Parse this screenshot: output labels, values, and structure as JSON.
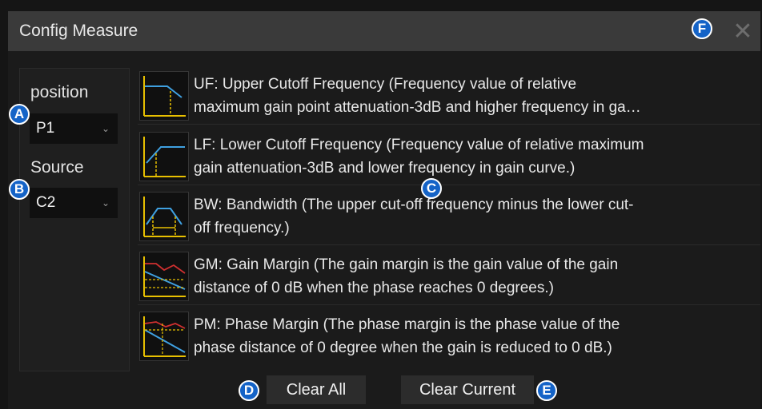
{
  "dialog": {
    "title": "Config Measure",
    "close_symbol": "✕"
  },
  "left": {
    "position_label": "position",
    "position_value": "P1",
    "source_label": "Source",
    "source_value": "C2"
  },
  "measures": [
    {
      "icon": "upper-cutoff-icon",
      "line1": "UF: Upper Cutoff Frequency (Frequency value of relative",
      "line2": "maximum gain point attenuation-3dB and higher frequency in ga…"
    },
    {
      "icon": "lower-cutoff-icon",
      "line1": "LF: Lower Cutoff Frequency (Frequency value of relative maximum",
      "line2": "gain attenuation-3dB and lower frequency in gain curve.)"
    },
    {
      "icon": "bandwidth-icon",
      "line1": "BW: Bandwidth (The upper cut-off frequency minus the lower cut-",
      "line2": "off frequency.)"
    },
    {
      "icon": "gain-margin-icon",
      "line1": "GM: Gain Margin (The gain margin is the gain value of the gain",
      "line2": "distance of 0 dB when the phase reaches 0 degrees.)"
    },
    {
      "icon": "phase-margin-icon",
      "line1": "PM: Phase Margin (The phase margin is the phase value of the",
      "line2": "phase distance of 0 degree when the gain is reduced to 0 dB.)"
    }
  ],
  "buttons": {
    "clear_all": "Clear All",
    "clear_current": "Clear Current"
  },
  "callouts": {
    "a": "A",
    "b": "B",
    "c": "C",
    "d": "D",
    "e": "E",
    "f": "F"
  },
  "colors": {
    "callout": "#1463c7",
    "icon_yellow": "#e8c000",
    "icon_blue": "#3fa0e0",
    "icon_red": "#d03030"
  }
}
